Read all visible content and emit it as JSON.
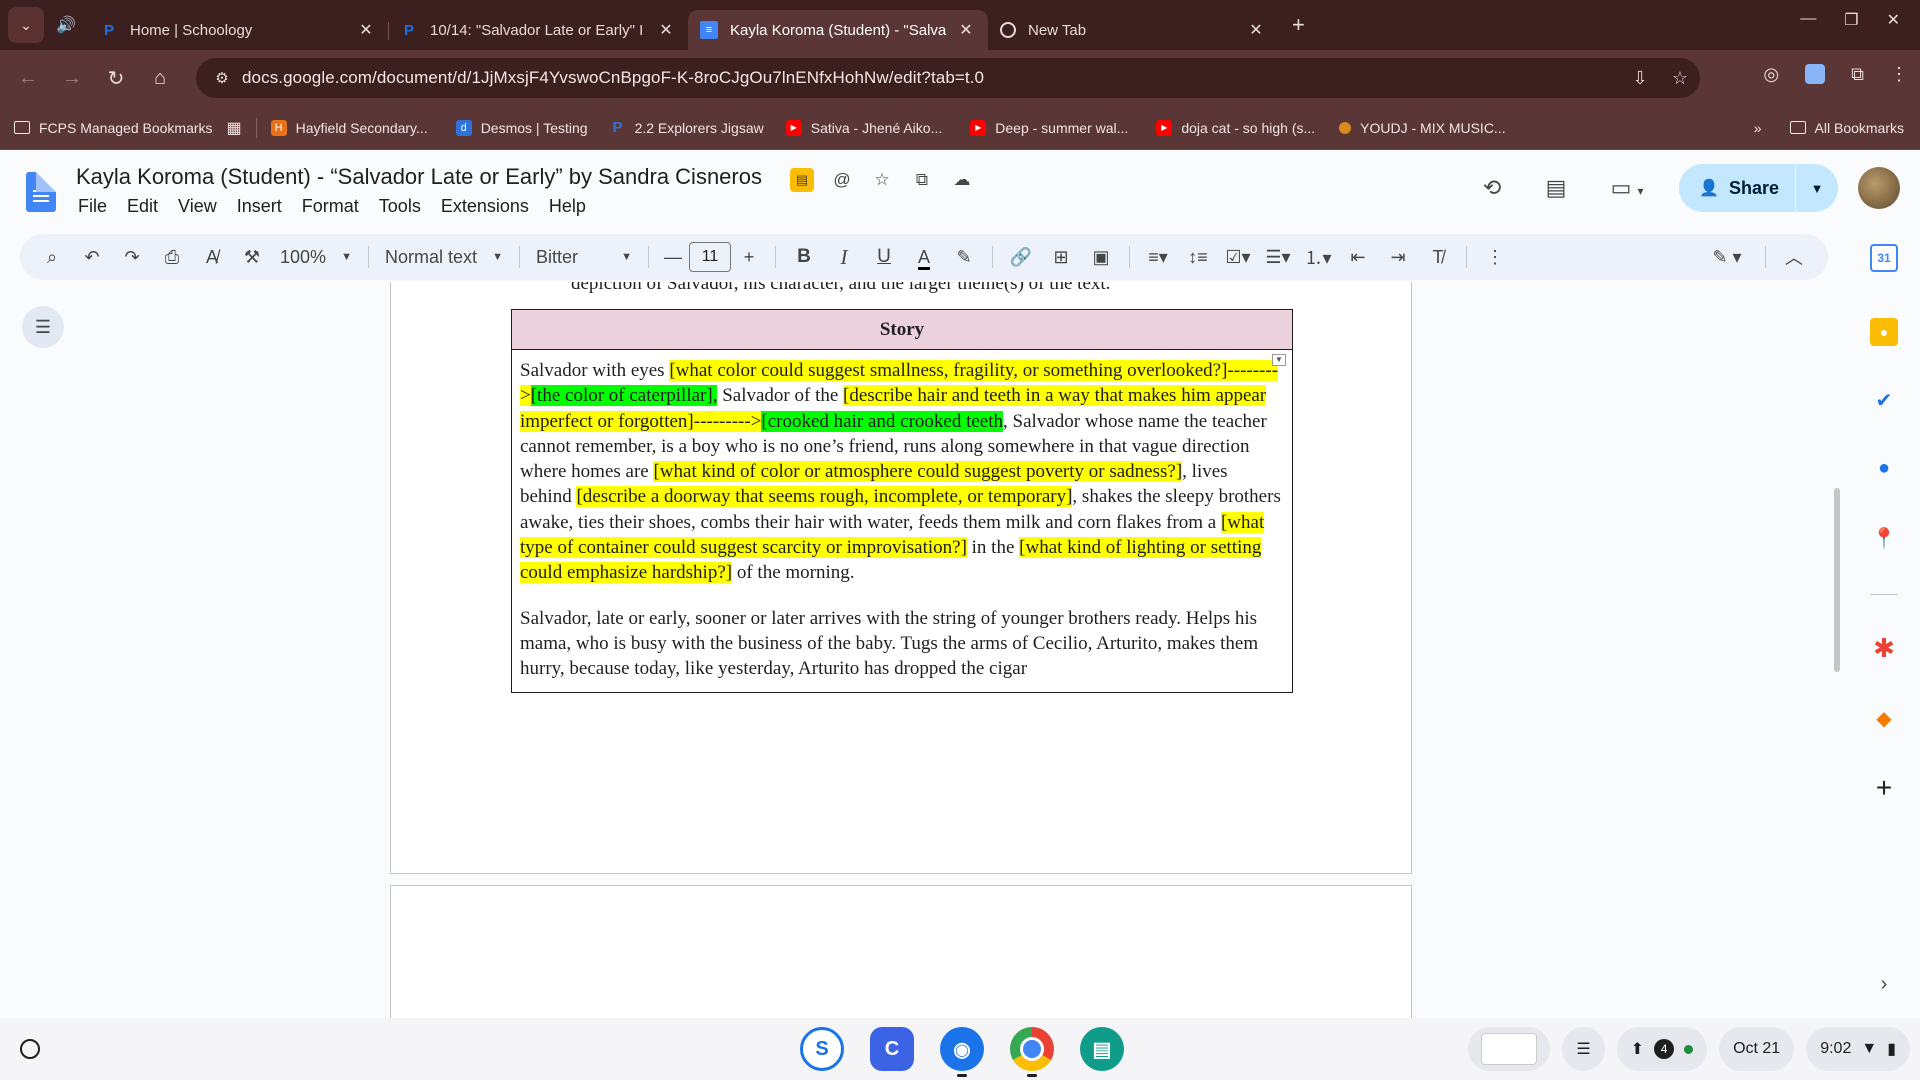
{
  "browser": {
    "tabs": [
      {
        "title": "Home | Schoology",
        "favicon": "P",
        "active": false
      },
      {
        "title": "10/14: \"Salvador Late or Early\" I",
        "favicon": "P",
        "active": false
      },
      {
        "title": "Kayla Koroma (Student) - \"Salva",
        "favicon": "docs",
        "active": true
      },
      {
        "title": "New Tab",
        "favicon": "chrome",
        "active": false
      }
    ],
    "url": "docs.google.com/document/d/1JjMxsjF4YvswoCnBpgoF-K-8roCJgOu7lnENfxHohNw/edit?tab=t.0",
    "bookmarks": [
      {
        "label": "FCPS Managed Bookmarks",
        "icon": "folder-icon"
      },
      {
        "label": "Hayfield Secondary...",
        "icon": "hayfield-icon"
      },
      {
        "label": "Desmos | Testing",
        "icon": "desmos-icon"
      },
      {
        "label": "2.2 Explorers Jigsaw",
        "icon": "schoology-icon"
      },
      {
        "label": "Sativa - Jhené Aiko...",
        "icon": "youtube-icon"
      },
      {
        "label": "Deep - summer wal...",
        "icon": "youtube-icon"
      },
      {
        "label": "doja cat - so high (s...",
        "icon": "youtube-icon"
      },
      {
        "label": "YOUDJ - MIX MUSIC...",
        "icon": "youdj-icon"
      }
    ],
    "all_bookmarks": "All Bookmarks"
  },
  "docs": {
    "title": "Kayla Koroma (Student) - “Salvador Late or Early” by Sandra Cisneros",
    "menu": [
      "File",
      "Edit",
      "View",
      "Insert",
      "Format",
      "Tools",
      "Extensions",
      "Help"
    ],
    "share_label": "Share",
    "toolbar": {
      "zoom": "100%",
      "style": "Normal text",
      "font": "Bitter",
      "font_size": "11",
      "bold": "B",
      "italic": "I",
      "underline": "U",
      "text_color": "A"
    }
  },
  "document": {
    "intro_line": "depiction of Salvador, his character, and the larger theme(s) of the text.",
    "table_header": "Story",
    "p1": {
      "t1": "Salvador with eyes ",
      "y1": "[what color could suggest smallness, fragility, or something overlooked?]-------->",
      "g1": "[the color of caterpillar],",
      "t2": " Salvador of the ",
      "y2": "[describe hair and teeth in a way that makes him appear imperfect or forgotten]--------->",
      "g2": "[crooked hair and crooked teeth",
      "t3": ", Salvador whose name the teacher cannot remember, is a boy who is no one’s friend, runs along somewhere in that vague direction where homes are ",
      "y3": "[what kind of color or atmosphere could suggest poverty or sadness?]",
      "t4": ", lives behind ",
      "y4": "[describe a doorway that seems rough, incomplete, or temporary]",
      "t5": ", shakes the sleepy brothers awake, ties their shoes, combs their hair with water, feeds them milk and corn flakes from a ",
      "y5": "[what type of container could suggest scarcity or improvisation?]",
      "t6": " in the ",
      "y6": "[what kind of lighting or setting could emphasize hardship?]",
      "t7": " of the morning."
    },
    "p2": "Salvador, late or early, sooner or later arrives with the string of younger brothers ready. Helps his mama, who is busy with the business of the baby. Tugs the arms of Cecilio, Arturito, makes them hurry, because today, like yesterday, Arturito has dropped the cigar"
  },
  "shelf": {
    "date": "Oct 21",
    "time": "9:02",
    "notification_count": "4"
  },
  "colors": {
    "tab_strip": "#3c1f1f",
    "toolbar": "#5b3636",
    "highlight_yellow": "#ffff00",
    "highlight_green": "#00ff00",
    "table_header_bg": "#ead1dc",
    "share_bg": "#c2e7ff"
  }
}
